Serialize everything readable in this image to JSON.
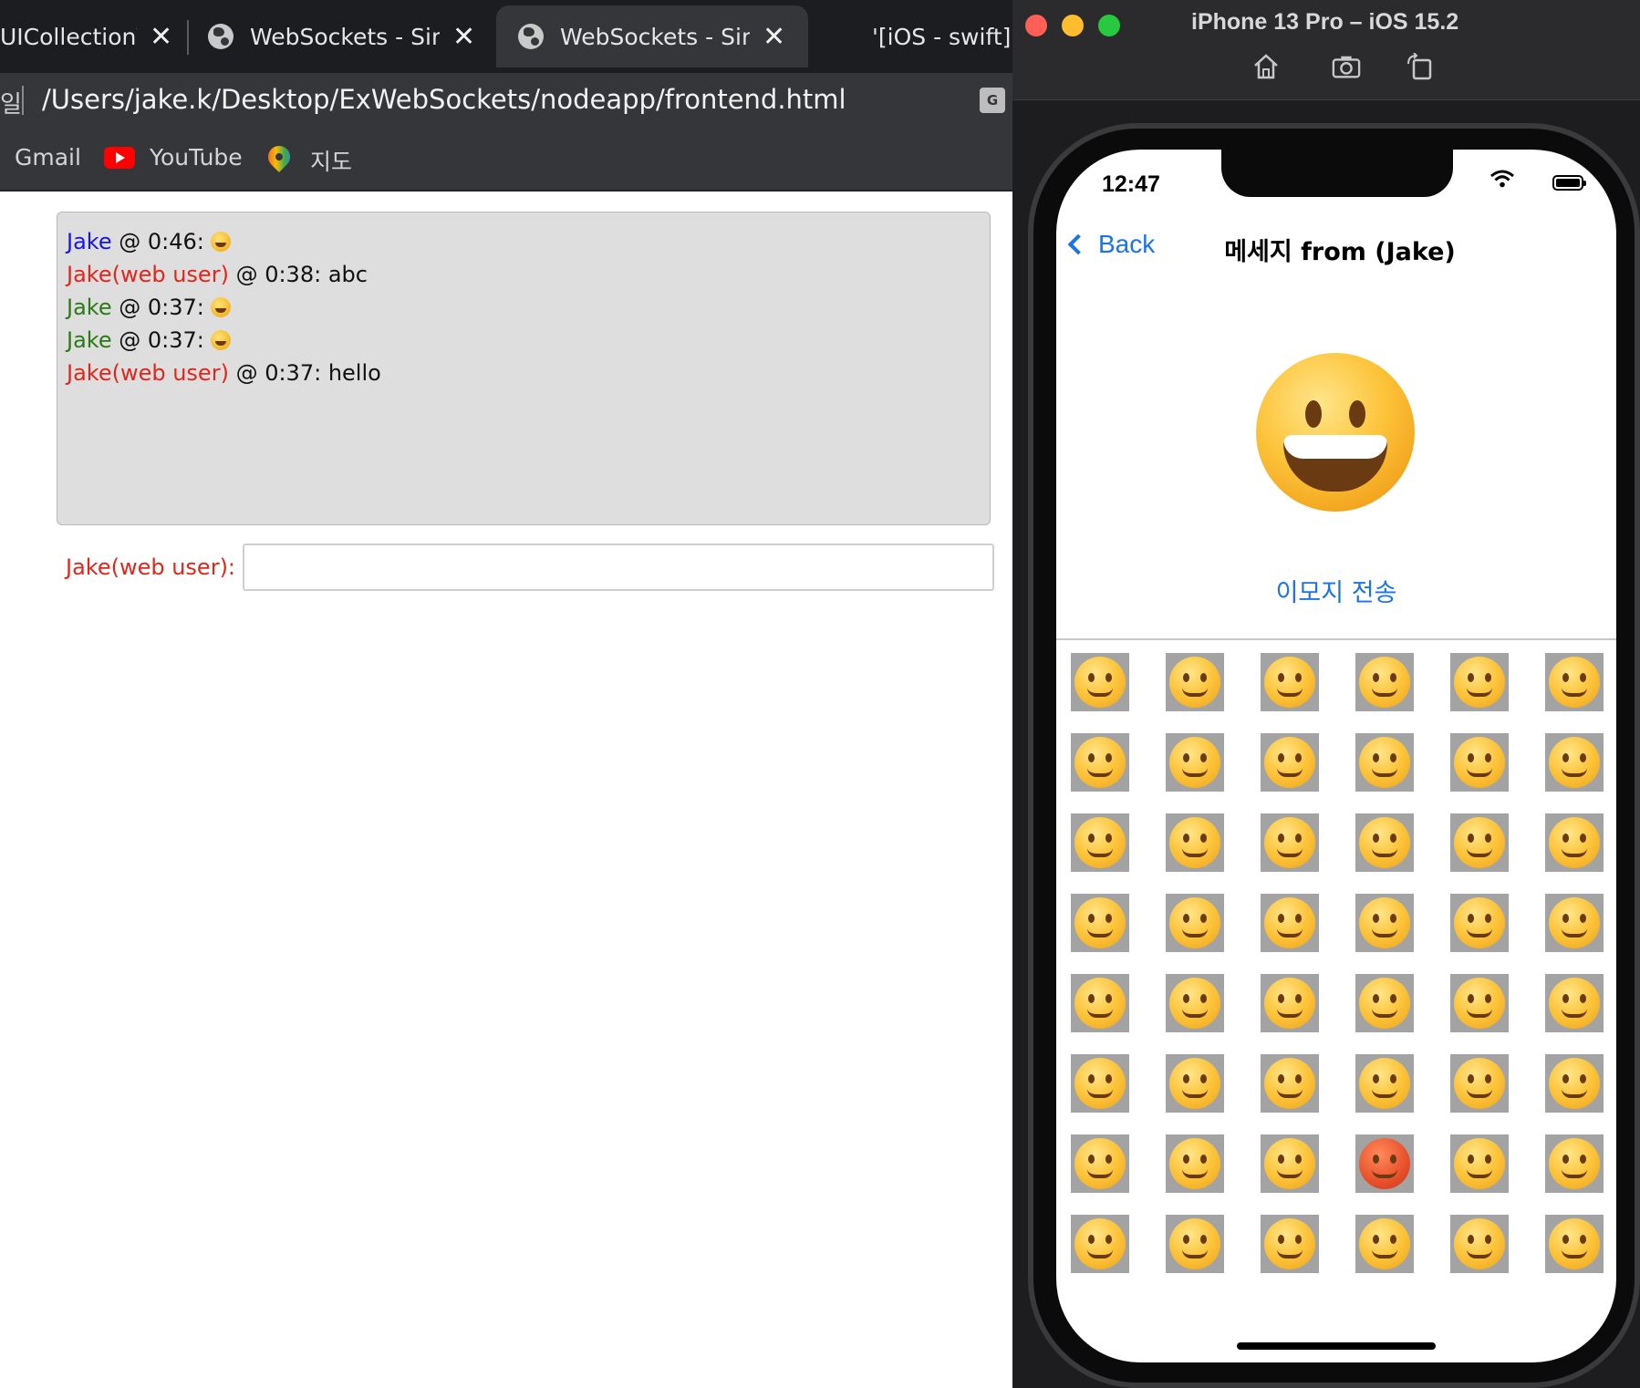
{
  "browser": {
    "tabs": [
      {
        "title": "UICollectionVi",
        "active": false
      },
      {
        "title": "WebSockets - Sim",
        "active": false
      },
      {
        "title": "WebSockets - Sim",
        "active": true
      },
      {
        "title": "'[iOS - swift]",
        "active": false
      }
    ],
    "close_glyph": "✕",
    "address_lead": "일",
    "url": "/Users/jake.k/Desktop/ExWebSockets/nodeapp/frontend.html",
    "bookmarks": [
      {
        "label": "Gmail",
        "icon": "gmail-icon"
      },
      {
        "label": "YouTube",
        "icon": "youtube-icon"
      },
      {
        "label": "지도",
        "icon": "maps-icon"
      }
    ]
  },
  "chat": {
    "messages": [
      {
        "sender": "Jake",
        "color": "#1515e6",
        "meta": " @ 0:46: ",
        "text": "",
        "emoji": "grinning-face"
      },
      {
        "sender": "Jake(web user)",
        "color": "#e2261b",
        "meta": " @ 0:38: ",
        "text": "abc",
        "emoji": ""
      },
      {
        "sender": "Jake",
        "color": "#2a7a16",
        "meta": " @ 0:37: ",
        "text": "",
        "emoji": "winking-face"
      },
      {
        "sender": "Jake",
        "color": "#2a7a16",
        "meta": " @ 0:37: ",
        "text": "",
        "emoji": "grinning-face"
      },
      {
        "sender": "Jake(web user)",
        "color": "#e2261b",
        "meta": " @ 0:37: ",
        "text": "hello",
        "emoji": ""
      }
    ],
    "input_label": "Jake(web user):",
    "input_value": ""
  },
  "simulator": {
    "title": "iPhone 13 Pro – iOS 15.2",
    "tools": [
      "home-icon",
      "screenshot-icon",
      "rotate-icon"
    ],
    "status_time": "12:47",
    "nav_back": "Back",
    "nav_title": "메세지 from (Jake)",
    "selected_emoji": "grinning-face",
    "send_button": "이모지 전송",
    "emoji_rows": 8,
    "emoji_cols": 6
  },
  "colors": {
    "accent_blue": "#1a73e8",
    "web_user_red": "#e2261b"
  }
}
